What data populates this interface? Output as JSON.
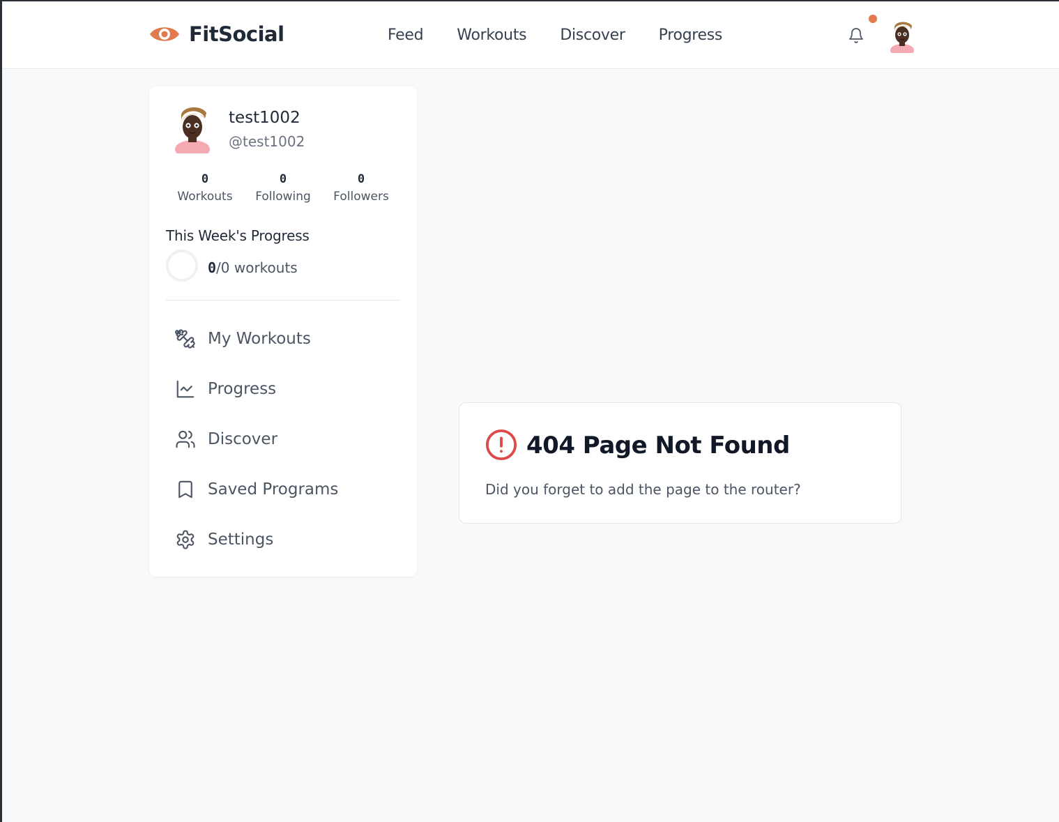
{
  "app": {
    "name": "FitSocial",
    "accent_color": "#e07a4f"
  },
  "header": {
    "nav": [
      {
        "label": "Feed"
      },
      {
        "label": "Workouts"
      },
      {
        "label": "Discover"
      },
      {
        "label": "Progress"
      }
    ],
    "notification_icon": "bell-icon",
    "has_notification": true
  },
  "profile": {
    "username": "test1002",
    "handle": "@test1002",
    "stats": [
      {
        "value": "0",
        "label": "Workouts"
      },
      {
        "value": "0",
        "label": "Following"
      },
      {
        "value": "0",
        "label": "Followers"
      }
    ],
    "weekly_progress": {
      "title": "This Week's Progress",
      "completed": "0",
      "suffix": "/0 workouts",
      "fraction": 0
    }
  },
  "sidebar_menu": [
    {
      "label": "My Workouts",
      "icon": "dumbbell-icon"
    },
    {
      "label": "Progress",
      "icon": "line-chart-icon"
    },
    {
      "label": "Discover",
      "icon": "users-icon"
    },
    {
      "label": "Saved Programs",
      "icon": "bookmark-icon"
    },
    {
      "label": "Settings",
      "icon": "gear-icon"
    }
  ],
  "error": {
    "title": "404 Page Not Found",
    "message": "Did you forget to add the page to the router?",
    "icon": "alert-circle-icon",
    "color": "#dc4a4a"
  }
}
